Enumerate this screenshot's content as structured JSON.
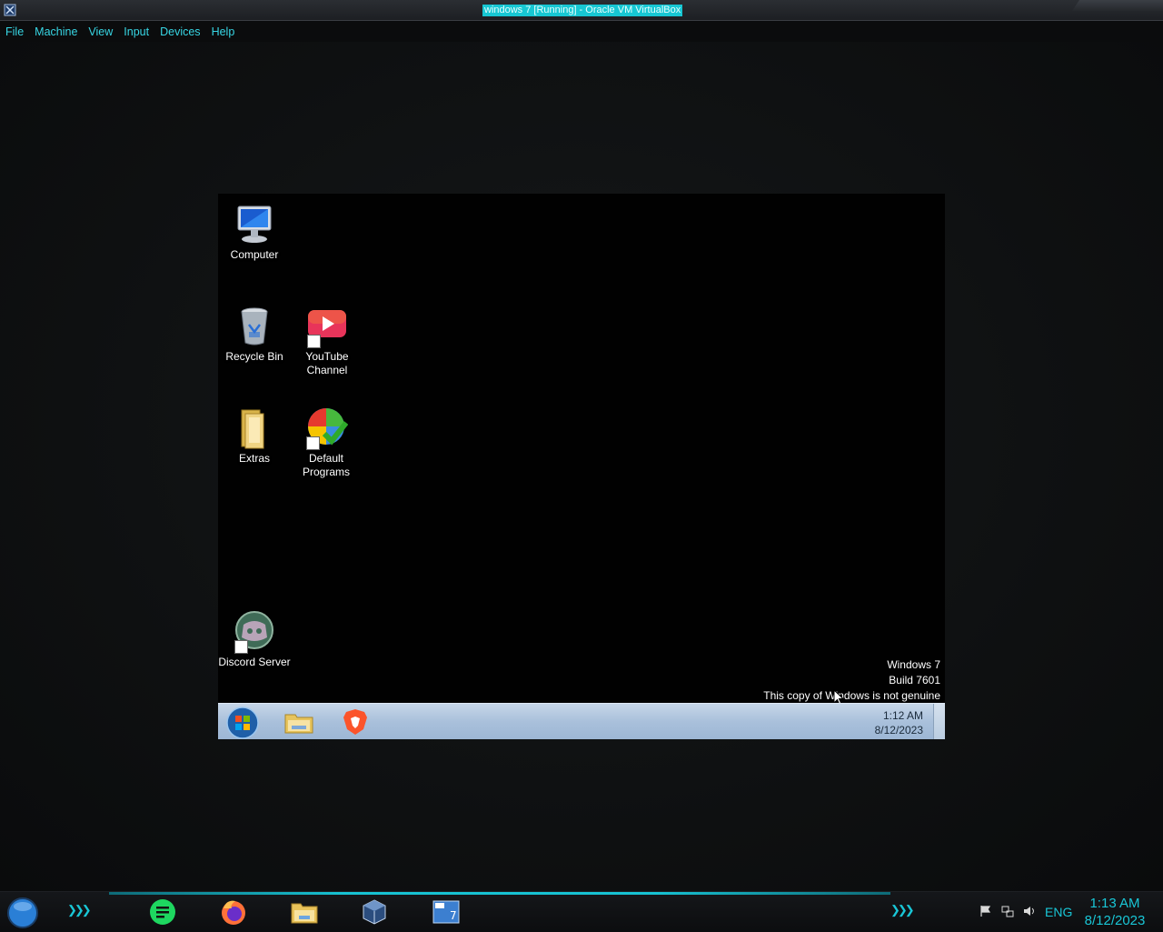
{
  "window": {
    "title": "windows 7 [Running] - Oracle VM VirtualBox",
    "icon": "virtualbox-icon"
  },
  "menu": {
    "items": [
      "File",
      "Machine",
      "View",
      "Input",
      "Devices",
      "Help"
    ]
  },
  "guest": {
    "desktop_icons": [
      {
        "label": "Computer",
        "icon": "computer-icon"
      },
      {
        "label": "Recycle Bin",
        "icon": "recycle-bin-icon"
      },
      {
        "label": "YouTube Channel",
        "icon": "youtube-icon"
      },
      {
        "label": "Extras",
        "icon": "folder-icon"
      },
      {
        "label": "Default Programs",
        "icon": "default-programs-icon"
      },
      {
        "label": "Discord Server",
        "icon": "discord-icon"
      }
    ],
    "watermark": {
      "line1": "Windows 7",
      "line2": "Build 7601",
      "line3": "This copy of Windows is not genuine"
    },
    "taskbar": {
      "pinned": [
        "start-orb-icon",
        "explorer-icon",
        "brave-icon"
      ],
      "clock_time": "1:12 AM",
      "clock_date": "8/12/2023"
    }
  },
  "host_taskbar": {
    "apps": [
      "start-orb-icon",
      "notes-app-icon",
      "firefox-icon",
      "file-explorer-icon",
      "virtualbox-icon",
      "windows7-vm-icon"
    ],
    "tray": [
      "flag-icon",
      "network-icon",
      "volume-icon"
    ],
    "language": "ENG",
    "clock_time": "1:13 AM",
    "clock_date": "8/12/2023"
  },
  "colors": {
    "accent": "#19c6d6",
    "title_highlight": "#17c7d3",
    "guest_taskbar": "#a9c0db"
  }
}
